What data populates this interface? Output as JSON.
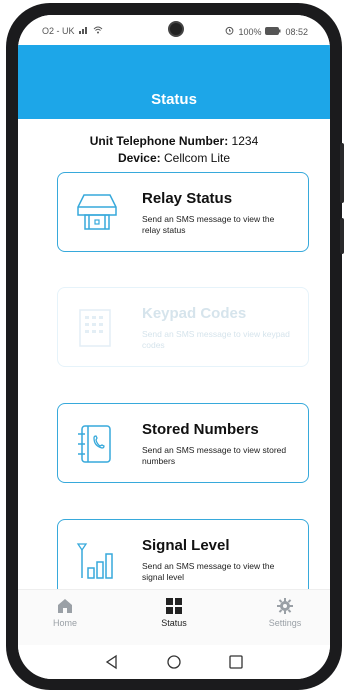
{
  "status_bar": {
    "carrier": "O2 - UK",
    "battery": "100%",
    "time": "08:52"
  },
  "header": {
    "title": "Status"
  },
  "info": {
    "phone_label": "Unit Telephone Number:",
    "phone_value": "1234",
    "device_label": "Device:",
    "device_value": "Cellcom Lite"
  },
  "cards": [
    {
      "title": "Relay Status",
      "desc": "Send an SMS message to view the relay status",
      "icon": "relay-icon",
      "enabled": true
    },
    {
      "title": "Keypad Codes",
      "desc": "Send an SMS message to view keypad codes",
      "icon": "keypad-icon",
      "enabled": false
    },
    {
      "title": "Stored Numbers",
      "desc": "Send an SMS message to view stored numbers",
      "icon": "phonebook-icon",
      "enabled": true
    },
    {
      "title": "Signal Level",
      "desc": "Send an SMS message to view the signal level",
      "icon": "signal-icon",
      "enabled": true
    }
  ],
  "bottom_nav": [
    {
      "label": "Home",
      "icon": "home-icon",
      "active": false
    },
    {
      "label": "Status",
      "icon": "grid-icon",
      "active": true
    },
    {
      "label": "Settings",
      "icon": "gear-icon",
      "active": false
    }
  ],
  "colors": {
    "header": "#1da6e8",
    "card_border": "#37a9db",
    "icon": "#37a9db"
  }
}
